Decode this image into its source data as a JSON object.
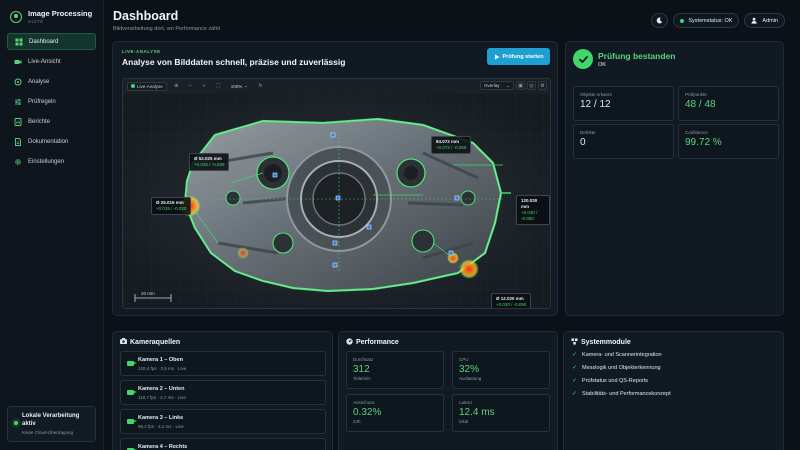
{
  "app": {
    "title": "Image Processing",
    "subtitle": "SUITE"
  },
  "sidebar": {
    "items": [
      {
        "label": "Dashboard",
        "icon": "grid-icon",
        "active": true
      },
      {
        "label": "Live-Ansicht",
        "icon": "video-icon"
      },
      {
        "label": "Analyse",
        "icon": "target-icon"
      },
      {
        "label": "Prüfregeln",
        "icon": "sliders-icon"
      },
      {
        "label": "Berichte",
        "icon": "report-icon"
      },
      {
        "label": "Dokumentation",
        "icon": "document-icon"
      },
      {
        "label": "Einstellungen",
        "icon": "gear-icon"
      }
    ],
    "local": {
      "title": "Lokale Verarbeitung aktiv",
      "subtitle": "Keine Cloud-Übertragung"
    }
  },
  "header": {
    "title": "Dashboard",
    "subtitle": "Bildverarbeitung dort, wo Performance zählt",
    "status": "Systemstatus: OK",
    "user": "Admin"
  },
  "live": {
    "tag": "LIVE-ANALYSE",
    "title": "Analyse von Bilddaten schnell, präzise und zuverlässig",
    "start_button": "Prüfung starten",
    "toolbar": {
      "badge": "Live-Analyse",
      "zoom": "100%",
      "overlay": "Overlay"
    },
    "measurements": [
      {
        "value": "Ø 52.025 mm",
        "tol": "+0.025 / -0.030"
      },
      {
        "value": "84.072 mm",
        "tol": "+0.072 / -0.050"
      },
      {
        "value": "Ø 25.015 mm",
        "tol": "+0.015 / -0.020"
      },
      {
        "value": "120.030 mm",
        "tol": "+0.030 / -0.050"
      },
      {
        "value": "Ø 12.020 mm",
        "tol": "+0.020 / -0.050"
      }
    ],
    "scale": "20 mm"
  },
  "result": {
    "title": "Prüfung bestanden",
    "subtitle": "OK",
    "stats": [
      {
        "label": "Objekte erkannt",
        "value": "12 / 12",
        "green": false
      },
      {
        "label": "Prüfpunkte",
        "value": "48 / 48",
        "green": true
      },
      {
        "label": "Defekte",
        "value": "0",
        "green": false
      },
      {
        "label": "Confidence",
        "value": "99.72 %",
        "green": true
      }
    ]
  },
  "cameras": {
    "title": "Kameraquellen",
    "items": [
      {
        "name": "Kamera 1 – Oben",
        "meta": "120,4 fps · 2,5 ms · Live"
      },
      {
        "name": "Kamera 2 – Unten",
        "meta": "118,7 fps · 2,7 ms · Live"
      },
      {
        "name": "Kamera 3 – Links",
        "meta": "96,2 fps · 3,1 ms · Live"
      },
      {
        "name": "Kamera 4 – Rechts",
        "meta": ""
      }
    ]
  },
  "performance": {
    "title": "Performance",
    "stats": [
      {
        "label": "Durchsatz",
        "value": "312",
        "unit": "Teile/min"
      },
      {
        "label": "CPU",
        "value": "32%",
        "unit": "Auslastung"
      },
      {
        "label": "Ausschuss",
        "value": "0.32%",
        "unit": "24h"
      },
      {
        "label": "Latenz",
        "value": "12.4 ms",
        "unit": "lokal"
      }
    ]
  },
  "modules": {
    "title": "Systemmodule",
    "items": [
      "Kamera- und Scannerintegration",
      "Messlogik und Objekterkennung",
      "Prüfstatus und QS-Reports",
      "Stabilitäts- und Performancekonzept"
    ]
  },
  "colors": {
    "accent": "#3fd66b",
    "button": "#1f9fd1",
    "background": "#0b1117"
  }
}
